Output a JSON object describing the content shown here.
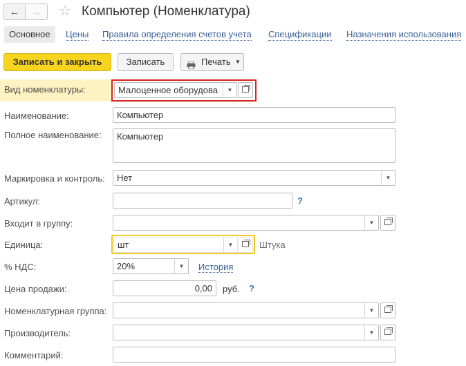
{
  "header": {
    "back_icon": "arrow-left-icon",
    "forward_icon": "arrow-right-icon",
    "favorite_icon": "star-icon",
    "title": "Компьютер (Номенклатура)"
  },
  "tabs": [
    {
      "label": "Основное"
    },
    {
      "label": "Цены"
    },
    {
      "label": "Правила определения счетов учета"
    },
    {
      "label": "Спецификации"
    },
    {
      "label": "Назначения использования"
    }
  ],
  "toolbar": {
    "save_close_label": "Записать и закрыть",
    "save_label": "Записать",
    "print_label": "Печать"
  },
  "form": {
    "kind_label": "Вид номенклатуры:",
    "kind_value": "Малоценное оборудова",
    "name_label": "Наименование:",
    "name_value": "Компьютер",
    "fullname_label": "Полное наименование:",
    "fullname_value": "Компьютер",
    "marking_label": "Маркировка и контроль:",
    "marking_value": "Нет",
    "article_label": "Артикул:",
    "article_value": "",
    "group_label": "Входит в группу:",
    "group_value": "",
    "unit_label": "Единица:",
    "unit_value": "шт",
    "unit_fullname": "Штука",
    "vat_label": "% НДС:",
    "vat_value": "20%",
    "vat_history_link": "История",
    "price_label": "Цена продажи:",
    "price_value": "0,00",
    "price_currency": "руб.",
    "nomgroup_label": "Номенклатурная группа:",
    "nomgroup_value": "",
    "producer_label": "Производитель:",
    "producer_value": "",
    "comment_label": "Комментарий:",
    "comment_value": "",
    "help_mark": "?"
  },
  "colors": {
    "primary_button": "#f7d41e",
    "highlight_row": "#fcf2c2",
    "focus_border": "#f0c919",
    "annotation_border": "#d8201d",
    "link": "#3a5f96"
  }
}
